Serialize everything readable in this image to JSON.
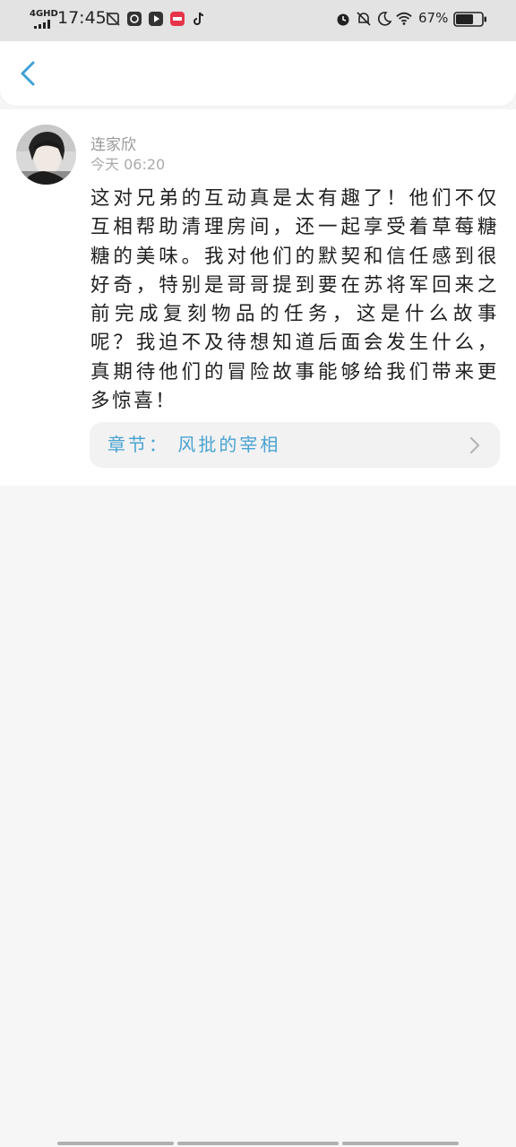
{
  "status_bar": {
    "network": "4GHD",
    "time": "17:45",
    "battery_percent": "67%"
  },
  "nav": {
    "back_icon": "chevron-left-icon"
  },
  "comment": {
    "username": "连家欣",
    "time": "今天 06:20",
    "text": "这对兄弟的互动真是太有趣了！他们不仅互相帮助清理房间，还一起享受着草莓糖糖的美味。我对他们的默契和信任感到很好奇，特别是哥哥提到要在苏将军回来之前完成复刻物品的任务，这是什么故事呢？我迫不及待想知道后面会发生什么，真期待他们的冒险故事能够给我们带来更多惊喜！",
    "chapter_label": "章节：  风批的宰相"
  },
  "colors": {
    "accent": "#4aa3d1",
    "status_bar_bg": "#e3e3e3",
    "page_bg": "#f7f6f7"
  }
}
